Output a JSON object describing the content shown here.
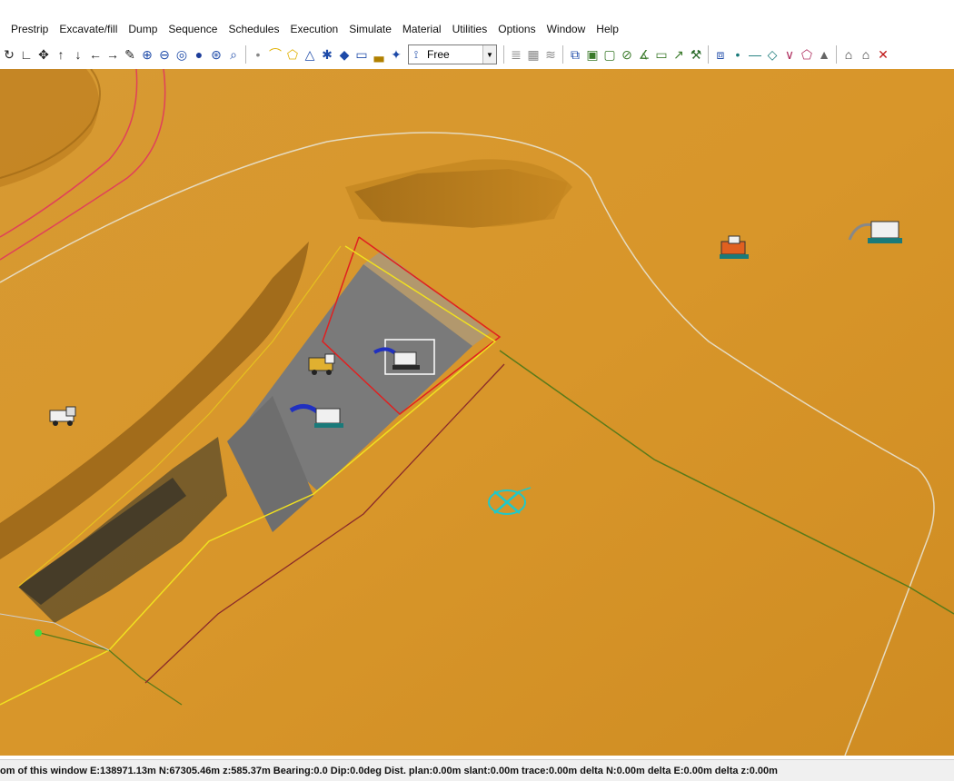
{
  "menu": [
    "Prestrip",
    "Excavate/fill",
    "Dump",
    "Sequence",
    "Schedules",
    "Execution",
    "Simulate",
    "Material",
    "Utilities",
    "Options",
    "Window",
    "Help"
  ],
  "toolbar": {
    "view_mode_select": {
      "value": "Free",
      "icon": "walker-icon"
    },
    "groups": [
      [
        {
          "name": "rotate-icon",
          "glyph": "↻",
          "color": "#222"
        },
        {
          "name": "axes-icon",
          "glyph": "∟",
          "color": "#222"
        },
        {
          "name": "move-icon",
          "glyph": "✥",
          "color": "#222"
        },
        {
          "name": "arrow-up-icon",
          "glyph": "↑",
          "color": "#222"
        },
        {
          "name": "arrow-down-icon",
          "glyph": "↓",
          "color": "#222"
        },
        {
          "name": "arrow-left-icon",
          "glyph": "←",
          "color": "#222"
        },
        {
          "name": "arrow-right-icon",
          "glyph": "→",
          "color": "#222"
        },
        {
          "name": "pencil-icon",
          "glyph": "✎",
          "color": "#222"
        },
        {
          "name": "zoom-in-icon",
          "glyph": "⊕",
          "color": "#1d4aa8"
        },
        {
          "name": "zoom-out-icon",
          "glyph": "⊖",
          "color": "#1d4aa8"
        },
        {
          "name": "zoom-extent-icon",
          "glyph": "◎",
          "color": "#1d4aa8"
        },
        {
          "name": "sphere-icon",
          "glyph": "●",
          "color": "#1d3d9a"
        },
        {
          "name": "target-icon",
          "glyph": "⊛",
          "color": "#1d4aa8"
        },
        {
          "name": "zoom-window-icon",
          "glyph": "⌕",
          "color": "#1d4aa8"
        }
      ],
      [
        {
          "name": "point-icon",
          "glyph": "•",
          "color": "#888"
        },
        {
          "name": "polyline-icon",
          "glyph": "⌒",
          "color": "#e0b000"
        },
        {
          "name": "polygon-icon",
          "glyph": "⬠",
          "color": "#e0b000"
        },
        {
          "name": "triangle-icon",
          "glyph": "△",
          "color": "#1d4aa8"
        },
        {
          "name": "grid-points-icon",
          "glyph": "✱",
          "color": "#1d4aa8"
        },
        {
          "name": "diamond-icon",
          "glyph": "◆",
          "color": "#1d4aa8"
        },
        {
          "name": "rectangle-icon",
          "glyph": "▭",
          "color": "#1d4aa8"
        },
        {
          "name": "chart-icon",
          "glyph": "▃",
          "color": "#b08000"
        },
        {
          "name": "direction-icon",
          "glyph": "✦",
          "color": "#1d4aa8"
        }
      ],
      [
        {
          "name": "layers-icon",
          "glyph": "≣",
          "color": "#888"
        },
        {
          "name": "layers-view-icon",
          "glyph": "▦",
          "color": "#888"
        },
        {
          "name": "layers-edit-icon",
          "glyph": "≋",
          "color": "#888"
        }
      ],
      [
        {
          "name": "select-object-icon",
          "glyph": "⧉",
          "color": "#1d4aa8"
        },
        {
          "name": "frame-icon",
          "glyph": "▣",
          "color": "#3a7a2a"
        },
        {
          "name": "box-icon",
          "glyph": "▢",
          "color": "#3a7a2a"
        },
        {
          "name": "link-icon",
          "glyph": "⊘",
          "color": "#3a7a2a"
        },
        {
          "name": "angle-icon",
          "glyph": "∡",
          "color": "#3a7a2a"
        },
        {
          "name": "window-icon",
          "glyph": "▭",
          "color": "#3a7a2a"
        },
        {
          "name": "pointer-icon",
          "glyph": "↗",
          "color": "#3a7a2a"
        },
        {
          "name": "excavator-icon",
          "glyph": "⚒",
          "color": "#2a6a2a"
        }
      ],
      [
        {
          "name": "pick-icon",
          "glyph": "⧈",
          "color": "#1d4aa8"
        },
        {
          "name": "dot-icon",
          "glyph": "•",
          "color": "#1a7a7a"
        },
        {
          "name": "line-icon",
          "glyph": "—",
          "color": "#1a7a7a"
        },
        {
          "name": "rhombus-icon",
          "glyph": "◇",
          "color": "#1a7a7a"
        },
        {
          "name": "vee-icon",
          "glyph": "∨",
          "color": "#b03060"
        },
        {
          "name": "pentagon-icon",
          "glyph": "⬠",
          "color": "#b03060"
        },
        {
          "name": "mound-icon",
          "glyph": "▲",
          "color": "#666"
        }
      ],
      [
        {
          "name": "home-icon",
          "glyph": "⌂",
          "color": "#333"
        },
        {
          "name": "home-set-icon",
          "glyph": "⌂",
          "color": "#333"
        },
        {
          "name": "close-icon",
          "glyph": "✕",
          "color": "#c01818"
        }
      ]
    ]
  },
  "status_bar": {
    "text": "om of this window   E:138971.13m N:67305.46m z:585.37m   Bearing:0.0 Dip:0.0deg   Dist. plan:0.00m slant:0.00m trace:0.00m   delta N:0.00m   delta E:0.00m   delta z:0.00m"
  },
  "colors": {
    "ground": "#d8962a",
    "pit_floor": "#7a7a7a",
    "boundary_red": "#e02020",
    "boundary_yellow": "#f0e020",
    "boundary_green": "#5a7a1a",
    "road_line": "#e0e0e0",
    "marker_cyan": "#20c8c8",
    "equipment_blue": "#2030c0"
  }
}
